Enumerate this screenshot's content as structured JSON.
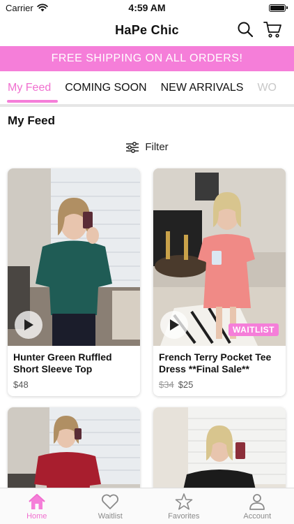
{
  "status": {
    "carrier": "Carrier",
    "time": "4:59 AM"
  },
  "header": {
    "title": "HaPe Chic",
    "icons": [
      "search-icon",
      "cart-icon"
    ]
  },
  "promo": {
    "text": "FREE SHIPPING ON ALL ORDERS!"
  },
  "tabs": [
    {
      "label": "My Feed",
      "active": true
    },
    {
      "label": "COMING SOON"
    },
    {
      "label": "NEW ARRIVALS"
    },
    {
      "label": "WO"
    }
  ],
  "feed": {
    "title": "My Feed",
    "filter_label": "Filter"
  },
  "products": [
    {
      "name": "Hunter Green Ruffled Short Sleeve Top",
      "price": "$48",
      "old_price": "",
      "badge": "",
      "top_color": "#1f5c55"
    },
    {
      "name": "French Terry Pocket Tee Dress **Final Sale**",
      "price": "$25",
      "old_price": "$34",
      "badge": "WAITLIST",
      "top_color": "#f08a86"
    },
    {
      "name": "",
      "price": "",
      "old_price": "",
      "badge": "",
      "top_color": "#a81e2e"
    },
    {
      "name": "",
      "price": "",
      "old_price": "",
      "badge": "",
      "top_color": "#1b1b1b"
    }
  ],
  "tabbar": [
    {
      "label": "Home",
      "icon": "home-icon",
      "active": true
    },
    {
      "label": "Waitlist",
      "icon": "heart-icon"
    },
    {
      "label": "Favorites",
      "icon": "star-icon"
    },
    {
      "label": "Account",
      "icon": "person-icon"
    }
  ],
  "colors": {
    "accent": "#f57ed9",
    "accent_text": "#f06fcf"
  }
}
